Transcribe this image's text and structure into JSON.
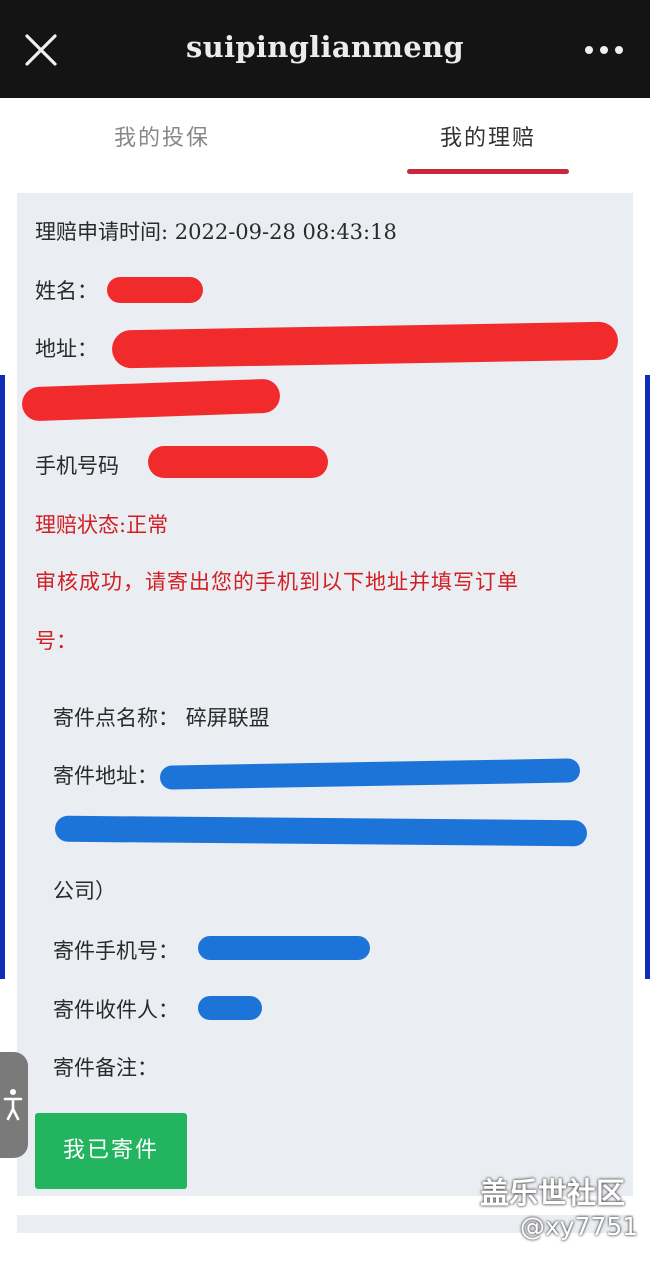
{
  "topbar": {
    "title": "suipinglianmeng",
    "close_icon": "close-icon",
    "more_icon": "more-icon"
  },
  "tabs": [
    {
      "label": "我的投保",
      "active": false
    },
    {
      "label": "我的理赔",
      "active": true
    }
  ],
  "claim": {
    "time_label": "理赔申请时间:",
    "time_value": "2022-09-28 08:43:18",
    "name_label": "姓名：",
    "address_label": "地址：",
    "phone_label": "手机号码",
    "status_label": "理赔状态:",
    "status_value": "正常",
    "message_line1": "审核成功，请寄出您的手机到以下地址并填写订单",
    "message_line2": "号："
  },
  "shipping": {
    "point_label": "寄件点名称：",
    "point_value": "碎屏联盟",
    "address_label": "寄件地址：",
    "address_tail": "公司）",
    "phone_label": "寄件手机号：",
    "receiver_label": "寄件收件人：",
    "notes_label": "寄件备注："
  },
  "actions": {
    "mailed_button": "我已寄件"
  },
  "watermark": {
    "name": "盖乐世社区",
    "handle": "@xy7751"
  },
  "colors": {
    "accent": "#c8283c",
    "status_red": "#d11f24",
    "button_green": "#22b45e",
    "redact_red": "#f12b2b",
    "redact_blue": "#1c74d9"
  }
}
